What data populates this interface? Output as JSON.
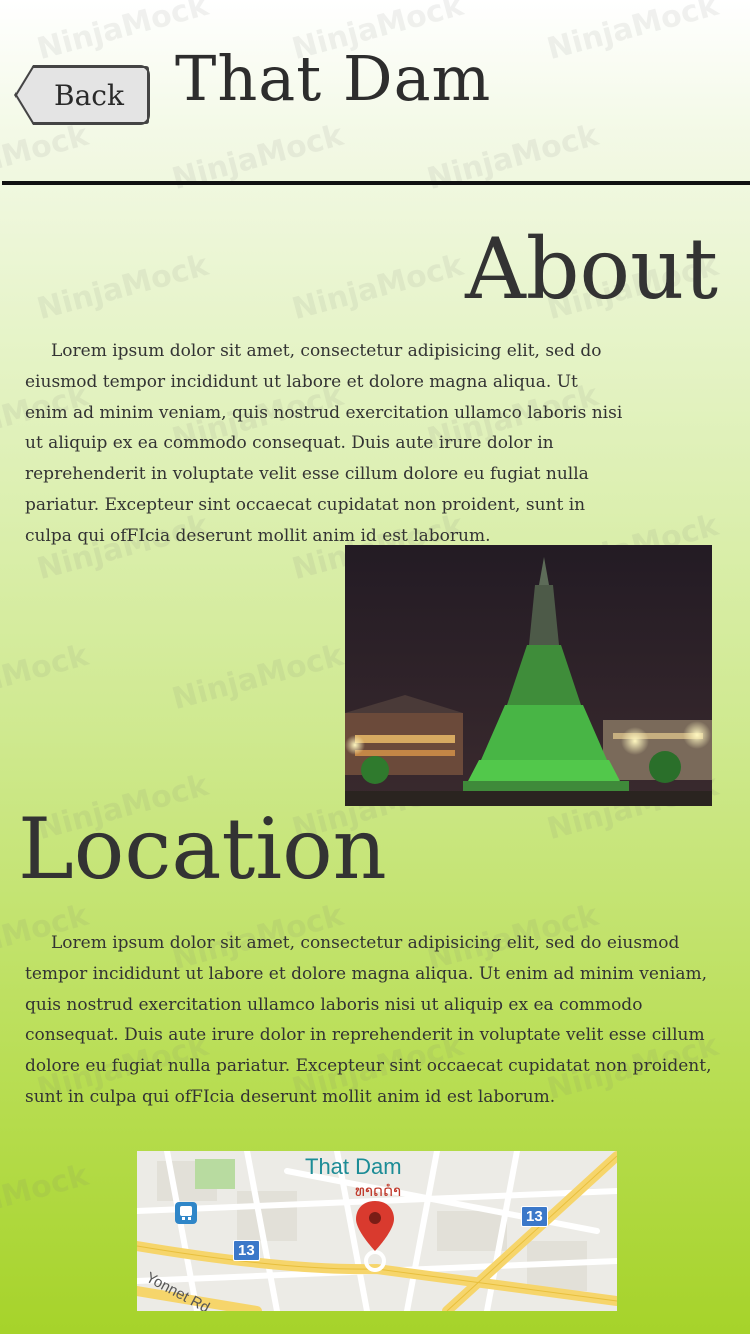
{
  "header": {
    "back_label": "Back",
    "title": "That Dam"
  },
  "about": {
    "heading": "About",
    "body": "Lorem ipsum dolor sit amet, consectetur adipisicing elit, sed do eiusmod tempor incididunt ut labore et dolore magna aliqua. Ut enim ad minim veniam, quis nostrud exercitation ullamco laboris nisi ut aliquip ex ea commodo consequat. Duis aute irure dolor in reprehenderit in voluptate velit esse cillum dolore eu fugiat nulla pariatur. Excepteur sint occaecat cupidatat non proident, sunt in culpa qui ofFIcia deserunt mollit anim id est laborum."
  },
  "location": {
    "heading": "Location",
    "body": "Lorem ipsum dolor sit amet, consectetur adipisicing elit, sed do eiusmod tempor incididunt ut labore et dolore magna aliqua. Ut enim ad minim veniam, quis nostrud exercitation ullamco laboris nisi ut aliquip ex ea commodo consequat. Duis aute irure dolor in reprehenderit in voluptate velit esse cillum dolore eu fugiat nulla pariatur. Excepteur sint occaecat cupidatat non proident, sunt in culpa qui ofFIcia deserunt mollit anim id est laborum."
  },
  "map": {
    "place_name": "That Dam",
    "place_name_local": "ທາດດຳ",
    "road_badge_1": "13",
    "road_badge_2": "13",
    "road_label": "Yonnet Rd",
    "marker_icon": "map-pin-icon",
    "transit_icon": "bus-icon",
    "pin_color": "#d93a2e"
  },
  "watermark": {
    "text": "NinjaMock"
  }
}
